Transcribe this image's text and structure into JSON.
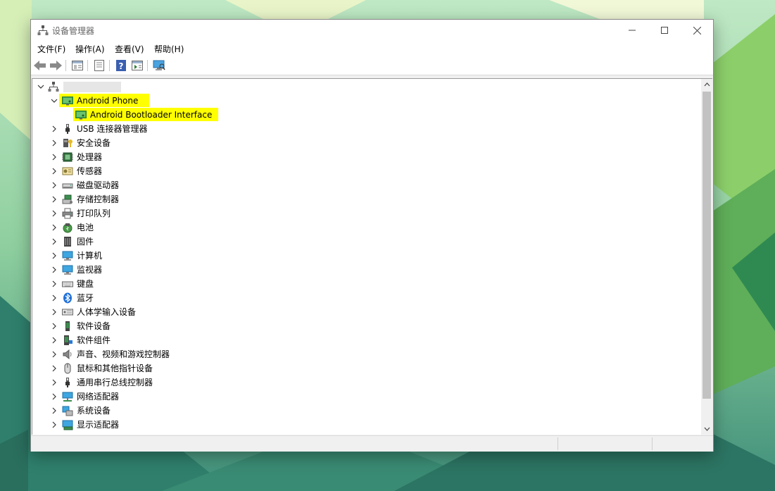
{
  "window": {
    "title": "设备管理器",
    "controls": [
      "minimize",
      "maximize",
      "close"
    ]
  },
  "menu": [
    "文件(F)",
    "操作(A)",
    "查看(V)",
    "帮助(H)"
  ],
  "toolbar": [
    "back-arrow-icon",
    "forward-arrow-icon",
    "show-hide-console-tree-icon",
    "properties-icon",
    "help-icon",
    "action-pane-icon",
    "scan-hardware-icon"
  ],
  "tree": {
    "root_label": "",
    "expanded_group": {
      "label": "Android Phone",
      "child": "Android Bootloader Interface",
      "highlight": "#ffff00"
    },
    "categories": [
      {
        "label": "USB 连接器管理器",
        "icon": "usb-connector-icon"
      },
      {
        "label": "安全设备",
        "icon": "security-device-icon"
      },
      {
        "label": "处理器",
        "icon": "processor-icon"
      },
      {
        "label": "传感器",
        "icon": "sensor-icon"
      },
      {
        "label": "磁盘驱动器",
        "icon": "disk-drive-icon"
      },
      {
        "label": "存储控制器",
        "icon": "storage-controller-icon"
      },
      {
        "label": "打印队列",
        "icon": "printer-icon"
      },
      {
        "label": "电池",
        "icon": "battery-icon"
      },
      {
        "label": "固件",
        "icon": "firmware-icon"
      },
      {
        "label": "计算机",
        "icon": "computer-icon"
      },
      {
        "label": "监视器",
        "icon": "monitor-icon"
      },
      {
        "label": "键盘",
        "icon": "keyboard-icon"
      },
      {
        "label": "蓝牙",
        "icon": "bluetooth-icon"
      },
      {
        "label": "人体学输入设备",
        "icon": "hid-icon"
      },
      {
        "label": "软件设备",
        "icon": "software-device-icon"
      },
      {
        "label": "软件组件",
        "icon": "software-component-icon"
      },
      {
        "label": "声音、视频和游戏控制器",
        "icon": "speaker-icon"
      },
      {
        "label": "鼠标和其他指针设备",
        "icon": "mouse-icon"
      },
      {
        "label": "通用串行总线控制器",
        "icon": "usb-controller-icon"
      },
      {
        "label": "网络适配器",
        "icon": "network-adapter-icon"
      },
      {
        "label": "系统设备",
        "icon": "system-device-icon"
      },
      {
        "label": "显示适配器",
        "icon": "display-adapter-icon"
      }
    ]
  }
}
